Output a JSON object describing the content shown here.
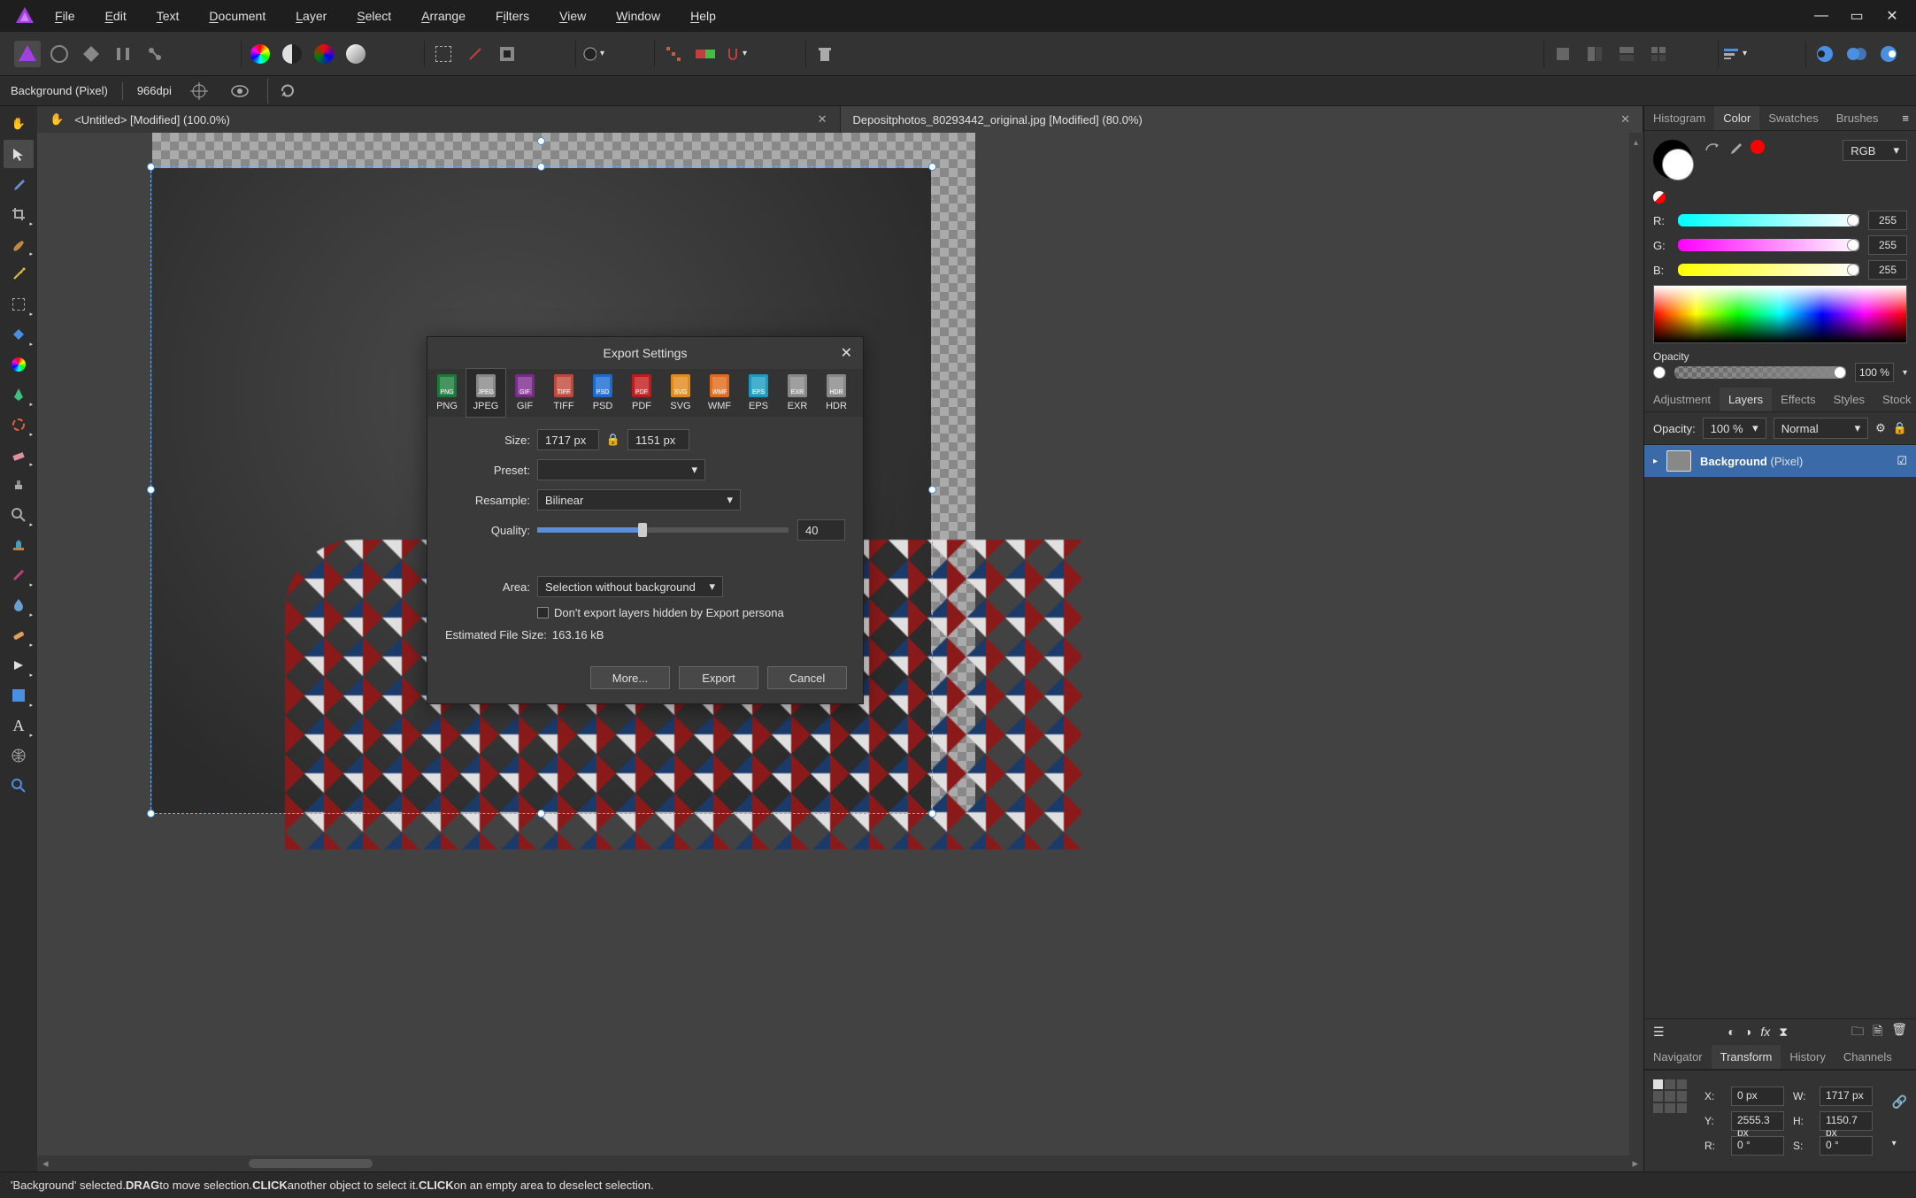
{
  "menu": {
    "items": [
      {
        "l": "F",
        "rest": "ile"
      },
      {
        "l": "E",
        "rest": "dit"
      },
      {
        "l": "T",
        "rest": "ext"
      },
      {
        "l": "D",
        "rest": "ocument"
      },
      {
        "l": "L",
        "rest": "ayer"
      },
      {
        "l": "S",
        "rest": "elect"
      },
      {
        "l": "A",
        "rest": "rrange"
      },
      {
        "l": "Fi",
        "rest": "lters",
        "u": "i"
      },
      {
        "l": "V",
        "rest": "iew"
      },
      {
        "l": "W",
        "rest": "indow"
      },
      {
        "l": "H",
        "rest": "elp"
      }
    ]
  },
  "context": {
    "layer": "Background (Pixel)",
    "dpi": "966dpi"
  },
  "tabs": [
    {
      "title": "<Untitled> [Modified] (100.0%)"
    },
    {
      "title": "Depositphotos_80293442_original.jpg [Modified] (80.0%)"
    }
  ],
  "panels": {
    "top_tabs": [
      "Histogram",
      "Color",
      "Swatches",
      "Brushes"
    ],
    "top_active": "Color",
    "color_mode": "RGB",
    "channels": [
      {
        "label": "R:",
        "value": "255",
        "grad": "linear-gradient(90deg,cyan,white)"
      },
      {
        "label": "G:",
        "value": "255",
        "grad": "linear-gradient(90deg,magenta,white)"
      },
      {
        "label": "B:",
        "value": "255",
        "grad": "linear-gradient(90deg,yellow,white)"
      }
    ],
    "opacity_label": "Opacity",
    "opacity_value": "100 %",
    "mid_tabs": [
      "Adjustment",
      "Layers",
      "Effects",
      "Styles",
      "Stock"
    ],
    "mid_active": "Layers",
    "layer_opacity_label": "Opacity:",
    "layer_opacity_value": "100 %",
    "blend_mode": "Normal",
    "layers": [
      {
        "name": "Background",
        "type": "(Pixel)",
        "visible": true
      }
    ],
    "bottom_tabs": [
      "Navigator",
      "Transform",
      "History",
      "Channels"
    ],
    "bottom_active": "Transform",
    "transform": {
      "X_label": "X:",
      "X": "0 px",
      "Y_label": "Y:",
      "Y": "2555.3 px",
      "W_label": "W:",
      "W": "1717 px",
      "H_label": "H:",
      "H": "1150.7 px",
      "R_label": "R:",
      "R": "0 °",
      "S_label": "S:",
      "S": "0 °"
    }
  },
  "statusbar": {
    "prefix": "'Background' selected. ",
    "b1": "DRAG",
    "t1": " to move selection. ",
    "b2": "CLICK",
    "t2": " another object to select it. ",
    "b3": "CLICK",
    "t3": " on an empty area to deselect selection."
  },
  "dialog": {
    "title": "Export Settings",
    "formats": [
      {
        "label": "PNG",
        "color": "#1a7a3a"
      },
      {
        "label": "JPEG",
        "color": "#888888"
      },
      {
        "label": "GIF",
        "color": "#7a2a8a"
      },
      {
        "label": "TIFF",
        "color": "#c0483a"
      },
      {
        "label": "PSD",
        "color": "#1a6ad0"
      },
      {
        "label": "PDF",
        "color": "#c01a1a"
      },
      {
        "label": "SVG",
        "color": "#e08a1a"
      },
      {
        "label": "WMF",
        "color": "#e06a1a"
      },
      {
        "label": "EPS",
        "color": "#1a9ac0"
      },
      {
        "label": "EXR",
        "color": "#888888"
      },
      {
        "label": "HDR",
        "color": "#888888"
      }
    ],
    "active_format": "JPEG",
    "size_label": "Size:",
    "size_w": "1717 px",
    "size_h": "1151 px",
    "preset_label": "Preset:",
    "preset_value": "",
    "resample_label": "Resample:",
    "resample_value": "Bilinear",
    "quality_label": "Quality:",
    "quality_value": "40",
    "area_label": "Area:",
    "area_value": "Selection without background",
    "hidden_layers_label": "Don't export layers hidden by Export persona",
    "filesize_label": "Estimated File Size:",
    "filesize_value": "163.16 kB",
    "buttons": {
      "more": "More...",
      "export": "Export",
      "cancel": "Cancel"
    }
  }
}
